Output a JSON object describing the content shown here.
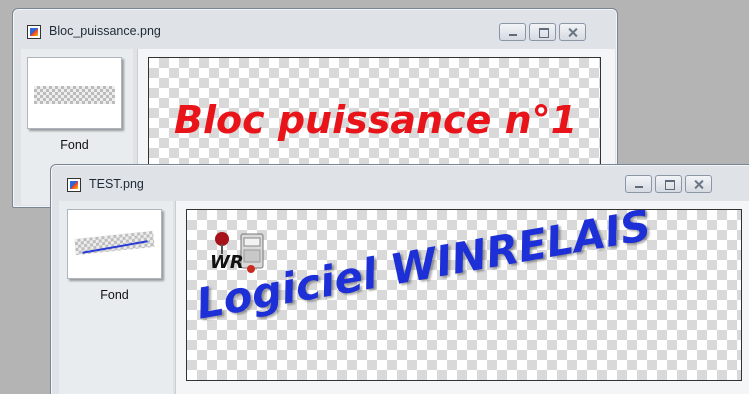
{
  "window_back": {
    "title": "Bloc_puissance.png",
    "layer_label": "Fond",
    "canvas_text": "Bloc puissance n°1",
    "canvas_text_color": "#e8141a"
  },
  "window_front": {
    "title": "TEST.png",
    "layer_label": "Fond",
    "canvas_text": "Logiciel WINRELAIS",
    "canvas_text_color": "#1d2fd6",
    "logo_text": "WR"
  }
}
